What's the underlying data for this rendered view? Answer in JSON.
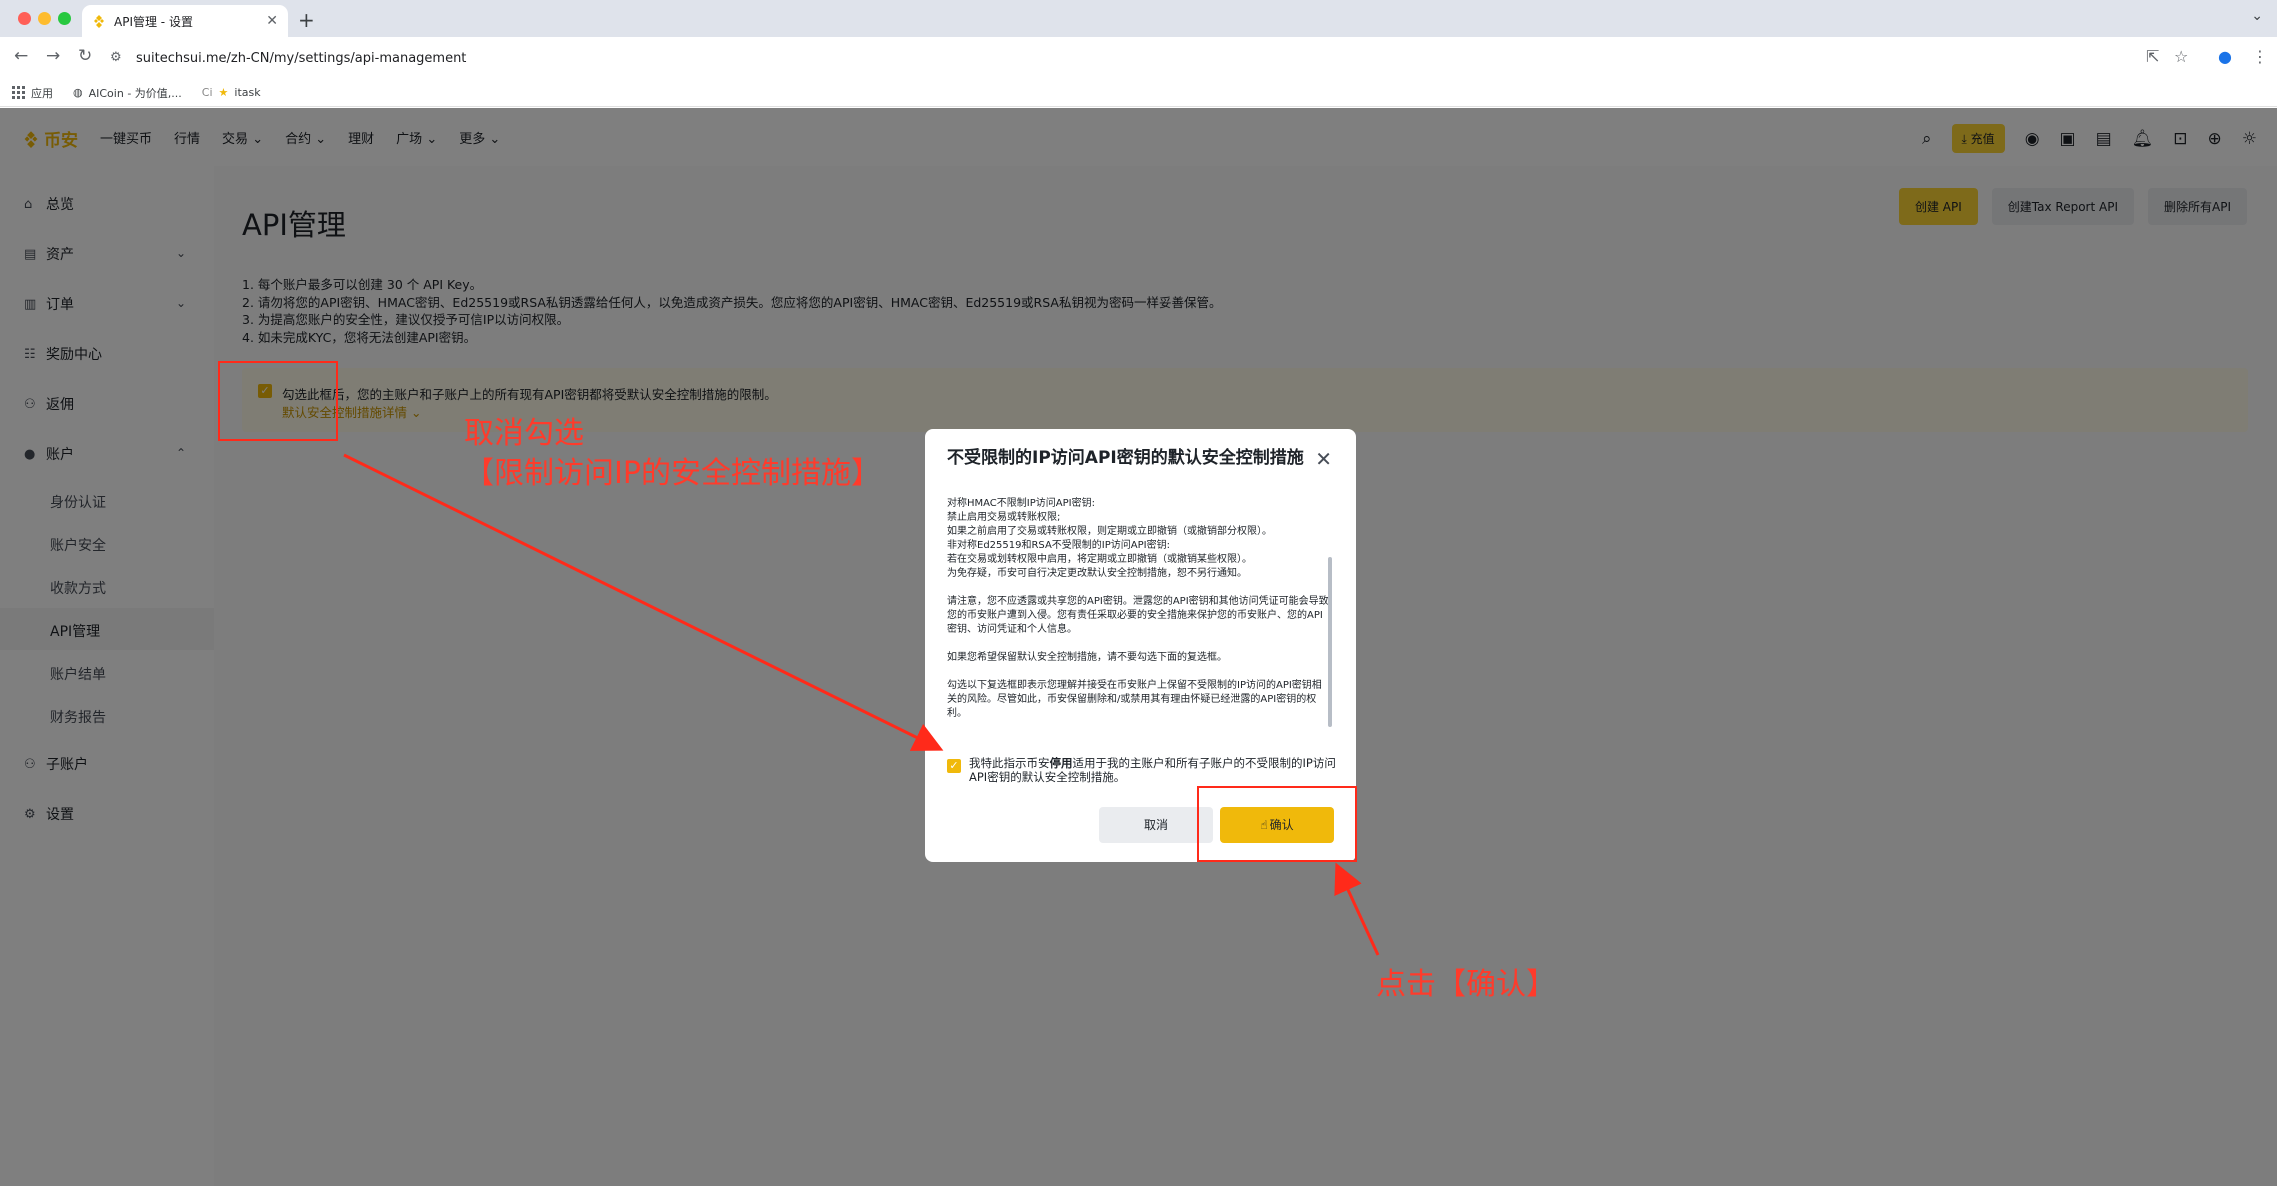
{
  "browser": {
    "tab_title": "API管理 - 设置",
    "url": "suitechsui.me/zh-CN/my/settings/api-management",
    "bookmarks": [
      "应用",
      "AICoin - 为价值,...",
      "itask"
    ],
    "bookmark_prefix": "Ci"
  },
  "topnav": {
    "logo": "币安",
    "items": [
      "一键买币",
      "行情",
      "交易",
      "合约",
      "理财",
      "广场",
      "更多"
    ],
    "deposit_label": "充值"
  },
  "sidebar": {
    "items": [
      "总览",
      "资产",
      "订单",
      "奖励中心",
      "返佣",
      "账户"
    ],
    "account_subitems": [
      "身份认证",
      "账户安全",
      "收款方式",
      "API管理",
      "账户结单",
      "财务报告"
    ],
    "bottom_items": [
      "子账户",
      "设置"
    ]
  },
  "main": {
    "title": "API管理",
    "buttons": [
      "创建 API",
      "创建Tax Report API",
      "删除所有API"
    ],
    "notes": [
      "1. 每个账户最多可以创建 30 个 API Key。",
      "2. 请勿将您的API密钥、HMAC密钥、Ed25519或RSA私钥透露给任何人，以免造成资产损失。您应将您的API密钥、HMAC密钥、Ed25519或RSA私钥视为密码一样妥善保管。",
      "3. 为提高您账户的安全性，建议仅授予可信IP以访问权限。",
      "4. 如未完成KYC，您将无法创建API密钥。"
    ],
    "warning_text": "勾选此框后，您的主账户和子账户上的所有现有API密钥都将受默认安全控制措施的限制。",
    "warning_link": "默认安全控制措施详情"
  },
  "modal": {
    "title": "不受限制的IP访问API密钥的默认安全控制措施",
    "body_lines_1": [
      "对称HMAC不限制IP访问API密钥:",
      "禁止启用交易或转账权限;",
      "如果之前启用了交易或转账权限，则定期或立即撤销（或撤销部分权限）。",
      "非对称Ed25519和RSA不受限制的IP访问API密钥:",
      "若在交易或划转权限中启用，将定期或立即撤销（或撤销某些权限）。",
      "为免存疑，币安可自行决定更改默认安全控制措施，恕不另行通知。"
    ],
    "body_para_2": "请注意，您不应透露或共享您的API密钥。泄露您的API密钥和其他访问凭证可能会导致您的币安账户遭到入侵。您有责任采取必要的安全措施来保护您的币安账户、您的API密钥、访问凭证和个人信息。",
    "body_para_3": "如果您希望保留默认安全控制措施，请不要勾选下面的复选框。",
    "body_para_4": "勾选以下复选框即表示您理解并接受在币安账户上保留不受限制的IP访问的API密钥相关的风险。尽管如此，币安保留删除和/或禁用其有理由怀疑已经泄露的API密钥的权利。",
    "checkbox_text_before": "我特此指示币安",
    "checkbox_text_bold": "停用",
    "checkbox_text_after": "适用于我的主账户和所有子账户的不受限制的IP访问API密钥的默认安全控制措施。",
    "cancel_label": "取消",
    "confirm_label": "确认"
  },
  "annotations": {
    "uncheck_line1": "取消勾选",
    "uncheck_line2": "【限制访问IP的安全控制措施】",
    "click_confirm": "点击【确认】",
    "color": "#ff2a1a"
  }
}
